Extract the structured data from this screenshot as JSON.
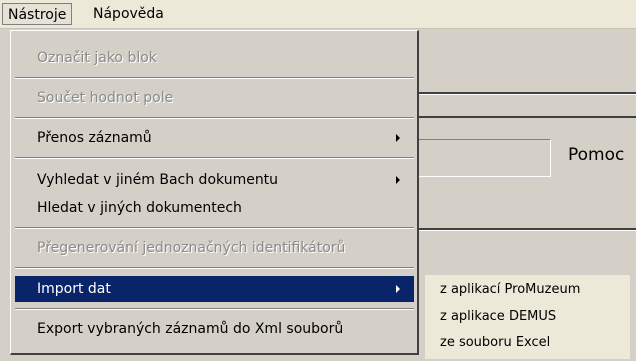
{
  "menubar": {
    "items": [
      {
        "label": "Nástroje"
      },
      {
        "label": "Nápověda"
      }
    ]
  },
  "background": {
    "pomoc_label": "Pomoc"
  },
  "menu": {
    "items": [
      {
        "label": "Označit jako blok",
        "disabled": true
      },
      {
        "label": "Součet hodnot pole",
        "disabled": true
      },
      {
        "label": "Přenos záznamů",
        "has_submenu": true
      },
      {
        "label": "Vyhledat v jiném Bach dokumentu",
        "has_submenu": true
      },
      {
        "label": "Hledat v jiných dokumentech"
      },
      {
        "label": "Přegenerování jednoznačných identifikátorů",
        "disabled": true
      },
      {
        "label": "Import dat",
        "has_submenu": true,
        "highlighted": true
      },
      {
        "label": "Export vybraných záznamů do Xml souborů"
      }
    ]
  },
  "submenu": {
    "items": [
      {
        "label": "z aplikací ProMuzeum"
      },
      {
        "label": "z aplikace DEMUS"
      },
      {
        "label": "ze souboru Excel"
      }
    ]
  },
  "colors": {
    "highlight": "#0a246a",
    "menu_bg": "#d4d0c8",
    "menubar_bg": "#ece9d8"
  }
}
